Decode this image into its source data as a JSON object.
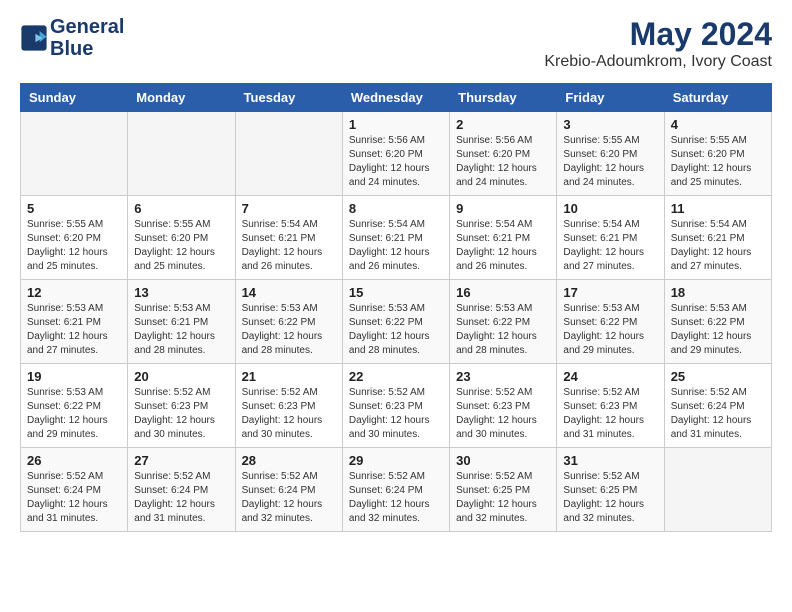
{
  "logo": {
    "line1": "General",
    "line2": "Blue"
  },
  "title": "May 2024",
  "subtitle": "Krebio-Adoumkrom, Ivory Coast",
  "headers": [
    "Sunday",
    "Monday",
    "Tuesday",
    "Wednesday",
    "Thursday",
    "Friday",
    "Saturday"
  ],
  "weeks": [
    [
      {
        "day": "",
        "info": ""
      },
      {
        "day": "",
        "info": ""
      },
      {
        "day": "",
        "info": ""
      },
      {
        "day": "1",
        "info": "Sunrise: 5:56 AM\nSunset: 6:20 PM\nDaylight: 12 hours\nand 24 minutes."
      },
      {
        "day": "2",
        "info": "Sunrise: 5:56 AM\nSunset: 6:20 PM\nDaylight: 12 hours\nand 24 minutes."
      },
      {
        "day": "3",
        "info": "Sunrise: 5:55 AM\nSunset: 6:20 PM\nDaylight: 12 hours\nand 24 minutes."
      },
      {
        "day": "4",
        "info": "Sunrise: 5:55 AM\nSunset: 6:20 PM\nDaylight: 12 hours\nand 25 minutes."
      }
    ],
    [
      {
        "day": "5",
        "info": "Sunrise: 5:55 AM\nSunset: 6:20 PM\nDaylight: 12 hours\nand 25 minutes."
      },
      {
        "day": "6",
        "info": "Sunrise: 5:55 AM\nSunset: 6:20 PM\nDaylight: 12 hours\nand 25 minutes."
      },
      {
        "day": "7",
        "info": "Sunrise: 5:54 AM\nSunset: 6:21 PM\nDaylight: 12 hours\nand 26 minutes."
      },
      {
        "day": "8",
        "info": "Sunrise: 5:54 AM\nSunset: 6:21 PM\nDaylight: 12 hours\nand 26 minutes."
      },
      {
        "day": "9",
        "info": "Sunrise: 5:54 AM\nSunset: 6:21 PM\nDaylight: 12 hours\nand 26 minutes."
      },
      {
        "day": "10",
        "info": "Sunrise: 5:54 AM\nSunset: 6:21 PM\nDaylight: 12 hours\nand 27 minutes."
      },
      {
        "day": "11",
        "info": "Sunrise: 5:54 AM\nSunset: 6:21 PM\nDaylight: 12 hours\nand 27 minutes."
      }
    ],
    [
      {
        "day": "12",
        "info": "Sunrise: 5:53 AM\nSunset: 6:21 PM\nDaylight: 12 hours\nand 27 minutes."
      },
      {
        "day": "13",
        "info": "Sunrise: 5:53 AM\nSunset: 6:21 PM\nDaylight: 12 hours\nand 28 minutes."
      },
      {
        "day": "14",
        "info": "Sunrise: 5:53 AM\nSunset: 6:22 PM\nDaylight: 12 hours\nand 28 minutes."
      },
      {
        "day": "15",
        "info": "Sunrise: 5:53 AM\nSunset: 6:22 PM\nDaylight: 12 hours\nand 28 minutes."
      },
      {
        "day": "16",
        "info": "Sunrise: 5:53 AM\nSunset: 6:22 PM\nDaylight: 12 hours\nand 28 minutes."
      },
      {
        "day": "17",
        "info": "Sunrise: 5:53 AM\nSunset: 6:22 PM\nDaylight: 12 hours\nand 29 minutes."
      },
      {
        "day": "18",
        "info": "Sunrise: 5:53 AM\nSunset: 6:22 PM\nDaylight: 12 hours\nand 29 minutes."
      }
    ],
    [
      {
        "day": "19",
        "info": "Sunrise: 5:53 AM\nSunset: 6:22 PM\nDaylight: 12 hours\nand 29 minutes."
      },
      {
        "day": "20",
        "info": "Sunrise: 5:52 AM\nSunset: 6:23 PM\nDaylight: 12 hours\nand 30 minutes."
      },
      {
        "day": "21",
        "info": "Sunrise: 5:52 AM\nSunset: 6:23 PM\nDaylight: 12 hours\nand 30 minutes."
      },
      {
        "day": "22",
        "info": "Sunrise: 5:52 AM\nSunset: 6:23 PM\nDaylight: 12 hours\nand 30 minutes."
      },
      {
        "day": "23",
        "info": "Sunrise: 5:52 AM\nSunset: 6:23 PM\nDaylight: 12 hours\nand 30 minutes."
      },
      {
        "day": "24",
        "info": "Sunrise: 5:52 AM\nSunset: 6:23 PM\nDaylight: 12 hours\nand 31 minutes."
      },
      {
        "day": "25",
        "info": "Sunrise: 5:52 AM\nSunset: 6:24 PM\nDaylight: 12 hours\nand 31 minutes."
      }
    ],
    [
      {
        "day": "26",
        "info": "Sunrise: 5:52 AM\nSunset: 6:24 PM\nDaylight: 12 hours\nand 31 minutes."
      },
      {
        "day": "27",
        "info": "Sunrise: 5:52 AM\nSunset: 6:24 PM\nDaylight: 12 hours\nand 31 minutes."
      },
      {
        "day": "28",
        "info": "Sunrise: 5:52 AM\nSunset: 6:24 PM\nDaylight: 12 hours\nand 32 minutes."
      },
      {
        "day": "29",
        "info": "Sunrise: 5:52 AM\nSunset: 6:24 PM\nDaylight: 12 hours\nand 32 minutes."
      },
      {
        "day": "30",
        "info": "Sunrise: 5:52 AM\nSunset: 6:25 PM\nDaylight: 12 hours\nand 32 minutes."
      },
      {
        "day": "31",
        "info": "Sunrise: 5:52 AM\nSunset: 6:25 PM\nDaylight: 12 hours\nand 32 minutes."
      },
      {
        "day": "",
        "info": ""
      }
    ]
  ]
}
